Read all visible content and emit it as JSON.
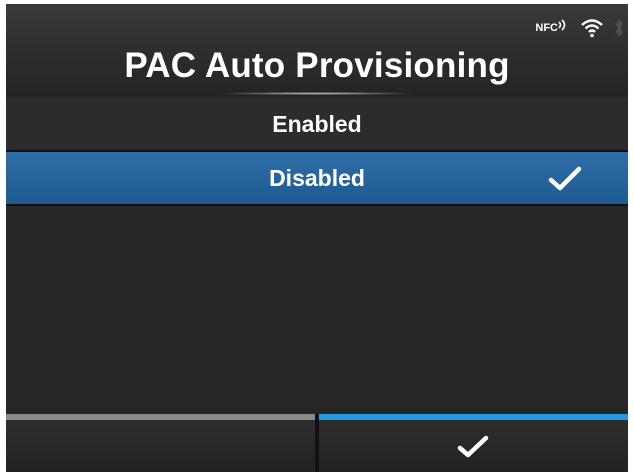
{
  "header": {
    "title": "PAC Auto Provisioning",
    "status_icons": {
      "nfc_label": "NFC",
      "wifi": "wifi-icon",
      "bluetooth": "bluetooth-icon"
    }
  },
  "options": [
    {
      "label": "Enabled",
      "selected": false
    },
    {
      "label": "Disabled",
      "selected": true
    }
  ],
  "softkeys": {
    "left": {
      "label": "",
      "icon": ""
    },
    "right": {
      "label": "",
      "icon": "checkmark-icon"
    }
  },
  "colors": {
    "selected_row": "#1f5a91",
    "confirm_bar": "#1f9be0",
    "back_bar": "#8a8a8a",
    "background": "#262626"
  }
}
